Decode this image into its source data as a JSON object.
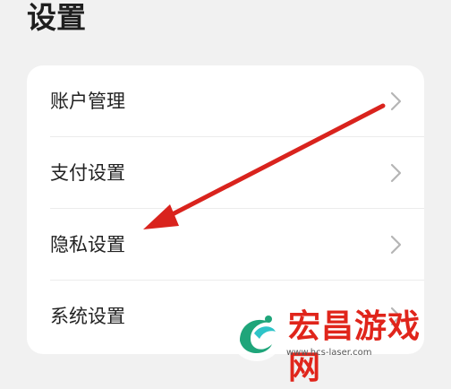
{
  "page": {
    "title": "设置"
  },
  "settings": {
    "items": [
      {
        "label": "账户管理",
        "icon": "chevron-right-icon"
      },
      {
        "label": "支付设置",
        "icon": "chevron-right-icon"
      },
      {
        "label": "隐私设置",
        "icon": "chevron-right-icon"
      },
      {
        "label": "系统设置",
        "icon": "chevron-right-icon"
      }
    ]
  },
  "annotation": {
    "arrow_color": "#d9231d"
  },
  "watermark": {
    "text": "宏昌游戏网",
    "url": "www.hcs-laser.com",
    "color": "#e0251b"
  }
}
